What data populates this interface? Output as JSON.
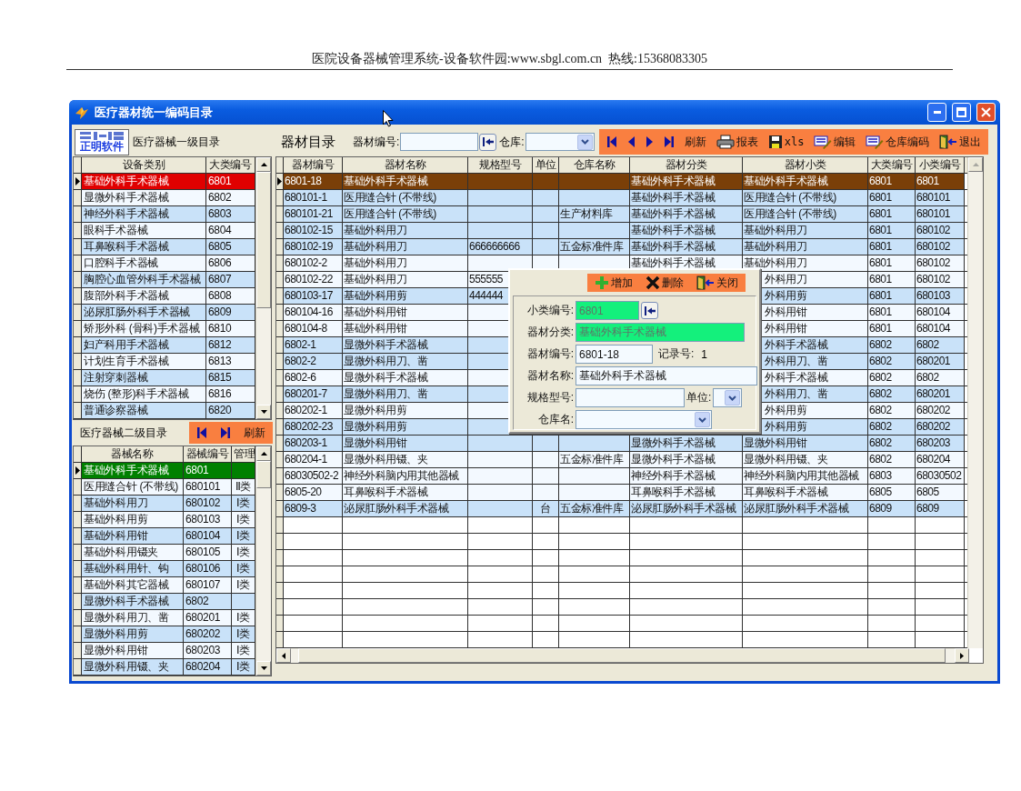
{
  "page_header": "医院设备器械管理系统-设备软件园:www.sbgl.com.cn  热线:15368083305",
  "window": {
    "title": "医疗器材统一编码目录"
  },
  "level1": {
    "logo_text": "正明软件",
    "title": "医疗器械一级目录",
    "columns": [
      "设备类别",
      "大类编号"
    ],
    "rows": [
      {
        "name": "基础外科手术器械",
        "code": "6801",
        "selected": true
      },
      {
        "name": "显微外科手术器械",
        "code": "6802",
        "selected": false
      },
      {
        "name": "神经外科手术器械",
        "code": "6803",
        "selected": false
      },
      {
        "name": "眼科手术器械",
        "code": "6804",
        "selected": false
      },
      {
        "name": "耳鼻喉科手术器械",
        "code": "6805",
        "selected": false
      },
      {
        "name": "口腔科手术器械",
        "code": "6806",
        "selected": false
      },
      {
        "name": "胸腔心血管外科手术器械",
        "code": "6807",
        "selected": false
      },
      {
        "name": "腹部外科手术器械",
        "code": "6808",
        "selected": false
      },
      {
        "name": "泌尿肛肠外科手术器械",
        "code": "6809",
        "selected": false
      },
      {
        "name": "矫形外科 (骨科)手术器械",
        "code": "6810",
        "selected": false
      },
      {
        "name": "妇产科用手术器械",
        "code": "6812",
        "selected": false
      },
      {
        "name": "计划生育手术器械",
        "code": "6813",
        "selected": false
      },
      {
        "name": "注射穿刺器械",
        "code": "6815",
        "selected": false
      },
      {
        "name": "烧伤 (整形)科手术器械",
        "code": "6816",
        "selected": false
      },
      {
        "name": "普通诊察器械",
        "code": "6820",
        "selected": false
      }
    ]
  },
  "level2": {
    "title": "医疗器械二级目录",
    "toolbar": [
      {
        "kind": "first"
      },
      {
        "kind": "last"
      },
      {
        "kind": "refresh",
        "label": "刷新"
      }
    ],
    "columns": [
      "器械名称",
      "器械编号",
      "管理"
    ],
    "rows": [
      {
        "name": "基础外科手术器械",
        "code": "6801",
        "selected": true
      },
      {
        "name": "医用缝合针 (不带线)",
        "code": "680101",
        "class": "Ⅱ类",
        "selected": false
      },
      {
        "name": "基础外科用刀",
        "code": "680102",
        "class": "Ⅰ类",
        "selected": false
      },
      {
        "name": "基础外科用剪",
        "code": "680103",
        "class": "Ⅰ类",
        "selected": false
      },
      {
        "name": "基础外科用钳",
        "code": "680104",
        "class": "Ⅰ类",
        "selected": false
      },
      {
        "name": "基础外科用镊夹",
        "code": "680105",
        "class": "Ⅰ类",
        "selected": false
      },
      {
        "name": "基础外科用针、钩",
        "code": "680106",
        "class": "Ⅰ类",
        "selected": false
      },
      {
        "name": "基础外科其它器械",
        "code": "680107",
        "class": "Ⅰ类",
        "selected": false
      },
      {
        "name": "显微外科手术器械",
        "code": "6802",
        "selected": false
      },
      {
        "name": "显微外科用刀、凿",
        "code": "680201",
        "class": "Ⅰ类",
        "selected": false
      },
      {
        "name": "显微外科用剪",
        "code": "680202",
        "class": "Ⅰ类",
        "selected": false
      },
      {
        "name": "显微外科用钳",
        "code": "680203",
        "class": "Ⅰ类",
        "selected": false
      },
      {
        "name": "显微外科用镊、夹",
        "code": "680204",
        "class": "Ⅰ类",
        "selected": false
      }
    ]
  },
  "catalog": {
    "title": "器材目录",
    "filters": [
      {
        "kind": "lookup",
        "label": "器材编号:"
      },
      {
        "kind": "dropdown",
        "label": "仓库:"
      }
    ],
    "toolbar": [
      {
        "kind": "first"
      },
      {
        "kind": "prev"
      },
      {
        "kind": "next"
      },
      {
        "kind": "last"
      },
      {
        "kind": "refresh",
        "label": "刷新"
      },
      {
        "kind": "print",
        "label": "报表"
      },
      {
        "kind": "save",
        "label": "xls"
      },
      {
        "kind": "edit",
        "label": "编辑"
      },
      {
        "kind": "edit",
        "label": "仓库编码"
      },
      {
        "kind": "exit",
        "label": "退出"
      }
    ],
    "columns": [
      "器材编号",
      "器材名称",
      "规格型号",
      "单位",
      "仓库名称",
      "器材分类",
      "器材小类",
      "大类编号",
      "小类编号"
    ],
    "rows": [
      {
        "code": "6801-18",
        "name": "基础外科手术器械",
        "category": "基础外科手术器械",
        "subcategory": "基础外科手术器械",
        "major_code": "6801",
        "minor_code": "6801",
        "selected": true,
        "covered": false
      },
      {
        "code": "680101-1",
        "name": "医用缝合针 (不带线)",
        "category": "基础外科手术器械",
        "subcategory": "医用缝合针 (不带线)",
        "major_code": "6801",
        "minor_code": "680101",
        "selected": false,
        "shaded": true,
        "covered": false
      },
      {
        "code": "680101-21",
        "name": "医用缝合针 (不带线)",
        "warehouse": "生产材料库",
        "category": "基础外科手术器械",
        "subcategory": "医用缝合针 (不带线)",
        "major_code": "6801",
        "minor_code": "680101",
        "selected": false,
        "shaded": true,
        "covered": false
      },
      {
        "code": "680102-15",
        "name": "基础外科用刀",
        "category": "基础外科手术器械",
        "subcategory": "基础外科用刀",
        "major_code": "6801",
        "minor_code": "680102",
        "selected": false,
        "shaded": true,
        "covered": false
      },
      {
        "code": "680102-19",
        "name": "基础外科用刀",
        "spec": "666666666",
        "warehouse": "五金标准件库",
        "category": "基础外科手术器械",
        "subcategory": "基础外科用刀",
        "major_code": "6801",
        "minor_code": "680102",
        "selected": false,
        "shaded": true,
        "covered": false
      },
      {
        "code": "680102-2",
        "name": "基础外科用刀",
        "category": "基础外科手术器械",
        "subcategory": "基础外科用刀",
        "major_code": "6801",
        "minor_code": "680102",
        "selected": false,
        "shaded": false,
        "covered": false
      },
      {
        "code": "680102-22",
        "name": "基础外科用刀",
        "spec": "555555",
        "subcategory": "外科用刀",
        "major_code": "6801",
        "minor_code": "680102",
        "selected": false,
        "shaded": false,
        "covered": true
      },
      {
        "code": "680103-17",
        "name": "基础外科用剪",
        "spec": "444444",
        "subcategory": "外科用剪",
        "major_code": "6801",
        "minor_code": "680103",
        "selected": false,
        "shaded": true,
        "covered": true
      },
      {
        "code": "680104-16",
        "name": "基础外科用钳",
        "subcategory": "外科用钳",
        "major_code": "6801",
        "minor_code": "680104",
        "selected": false,
        "shaded": false,
        "covered": true
      },
      {
        "code": "680104-8",
        "name": "基础外科用钳",
        "subcategory": "外科用钳",
        "major_code": "6801",
        "minor_code": "680104",
        "selected": false,
        "shaded": false,
        "covered": true
      },
      {
        "code": "6802-1",
        "name": "显微外科手术器械",
        "subcategory": "外科手术器械",
        "major_code": "6802",
        "minor_code": "6802",
        "selected": false,
        "shaded": true,
        "covered": true
      },
      {
        "code": "6802-2",
        "name": "显微外科用刀、凿",
        "subcategory": "外科用刀、凿",
        "major_code": "6802",
        "minor_code": "680201",
        "selected": false,
        "shaded": true,
        "covered": true
      },
      {
        "code": "6802-6",
        "name": "显微外科手术器械",
        "subcategory": "外科手术器械",
        "major_code": "6802",
        "minor_code": "6802",
        "selected": false,
        "shaded": false,
        "covered": true
      },
      {
        "code": "680201-7",
        "name": "显微外科用刀、凿",
        "subcategory": "外科用刀、凿",
        "major_code": "6802",
        "minor_code": "680201",
        "selected": false,
        "shaded": true,
        "covered": true
      },
      {
        "code": "680202-1",
        "name": "显微外科用剪",
        "subcategory": "外科用剪",
        "major_code": "6802",
        "minor_code": "680202",
        "selected": false,
        "shaded": false,
        "covered": true
      },
      {
        "code": "680202-23",
        "name": "显微外科用剪",
        "subcategory": "外科用剪",
        "major_code": "6802",
        "minor_code": "680202",
        "selected": false,
        "shaded": true,
        "covered": true
      },
      {
        "code": "680203-1",
        "name": "显微外科用钳",
        "category": "显微外科手术器械",
        "subcategory": "显微外科用钳",
        "major_code": "6802",
        "minor_code": "680203",
        "selected": false,
        "shaded": true,
        "covered": false
      },
      {
        "code": "680204-1",
        "name": "显微外科用镊、夹",
        "warehouse": "五金标准件库",
        "category": "显微外科手术器械",
        "subcategory": "显微外科用镊、夹",
        "major_code": "6802",
        "minor_code": "680204",
        "selected": false,
        "shaded": false,
        "covered": false
      },
      {
        "code": "68030502-2",
        "name": "神经外科脑内用其他器械",
        "category": "神经外科手术器械",
        "subcategory": "神经外科脑内用其他器械",
        "major_code": "6803",
        "minor_code": "68030502",
        "selected": false,
        "shaded": false,
        "covered": false
      },
      {
        "code": "6805-20",
        "name": "耳鼻喉科手术器械",
        "category": "耳鼻喉科手术器械",
        "subcategory": "耳鼻喉科手术器械",
        "major_code": "6805",
        "minor_code": "6805",
        "selected": false,
        "shaded": false,
        "covered": false
      },
      {
        "code": "6809-3",
        "name": "泌尿肛肠外科手术器械",
        "unit": "台",
        "warehouse": "五金标准件库",
        "category": "泌尿肛肠外科手术器械",
        "subcategory": "泌尿肛肠外科手术器械",
        "major_code": "6809",
        "minor_code": "6809",
        "selected": false,
        "shaded": true,
        "covered": false
      }
    ]
  },
  "dialog": {
    "toolbar": [
      {
        "kind": "add",
        "label": "增加"
      },
      {
        "kind": "delete",
        "label": "删除"
      },
      {
        "kind": "close",
        "label": "关闭"
      }
    ],
    "rows": [
      [
        {
          "kind": "lookup",
          "label": "小类编号:",
          "value": "6801",
          "locked": true
        }
      ],
      [
        {
          "kind": "text",
          "label": "器材分类:",
          "value": "基础外科手术器械",
          "locked": true
        }
      ],
      [
        {
          "kind": "text",
          "label": "器材编号:",
          "value": "6801-18",
          "locked": false
        },
        {
          "kind": "readout",
          "label": "记录号:",
          "value": "1"
        }
      ],
      [
        {
          "kind": "text",
          "label": "器材名称:",
          "value": "基础外科手术器械",
          "locked": false
        }
      ],
      [
        {
          "kind": "text",
          "label": "规格型号:",
          "locked": false
        },
        {
          "kind": "dropdown",
          "label": "单位:",
          "locked": false
        }
      ],
      [
        {
          "kind": "dropdown",
          "label": "仓库名:",
          "locked": false
        }
      ]
    ]
  }
}
